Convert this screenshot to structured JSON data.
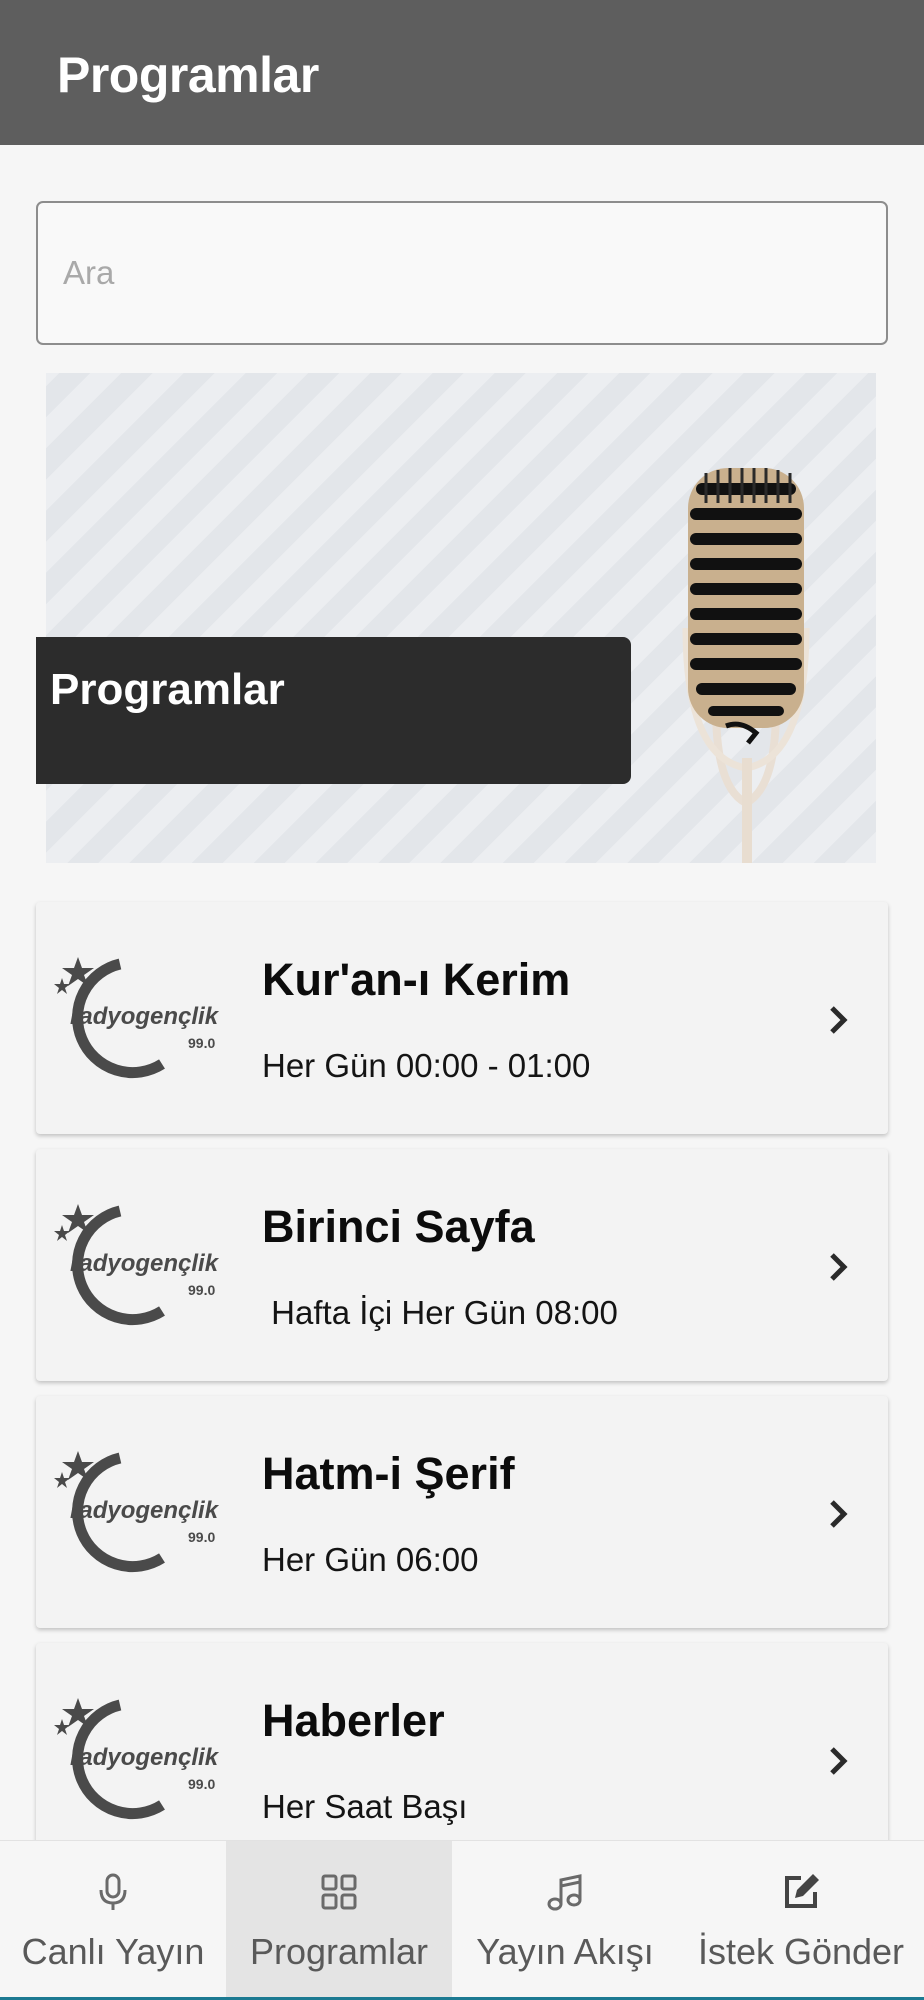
{
  "header": {
    "title": "Programlar"
  },
  "search": {
    "placeholder": "Ara",
    "value": ""
  },
  "banner": {
    "label": "Programlar"
  },
  "programs": [
    {
      "title": "Kur'an-ı Kerim",
      "schedule": "Her Gün 00:00 - 01:00",
      "logo_text": "radyogençlik",
      "logo_freq": "99.0"
    },
    {
      "title": "Birinci Sayfa",
      "schedule": " Hafta İçi Her Gün 08:00",
      "logo_text": "radyogençlik",
      "logo_freq": "99.0"
    },
    {
      "title": "Hatm-i Şerif",
      "schedule": "Her Gün 06:00",
      "logo_text": "radyogençlik",
      "logo_freq": "99.0"
    },
    {
      "title": "Haberler",
      "schedule": "Her Saat Başı",
      "logo_text": "radyogençlik",
      "logo_freq": "99.0"
    }
  ],
  "bottom_nav": {
    "items": [
      {
        "label": "Canlı Yayın",
        "icon": "microphone-icon",
        "active": false
      },
      {
        "label": "Programlar",
        "icon": "grid-icon",
        "active": true
      },
      {
        "label": "Yayın Akışı",
        "icon": "music-note-icon",
        "active": false
      },
      {
        "label": "İstek Gönder",
        "icon": "edit-icon",
        "active": false
      }
    ]
  },
  "colors": {
    "appbar": "#5e5e5e",
    "banner_label": "#2c2c2c",
    "nav_active": "#e4e4e4",
    "nav_text": "#595959"
  }
}
